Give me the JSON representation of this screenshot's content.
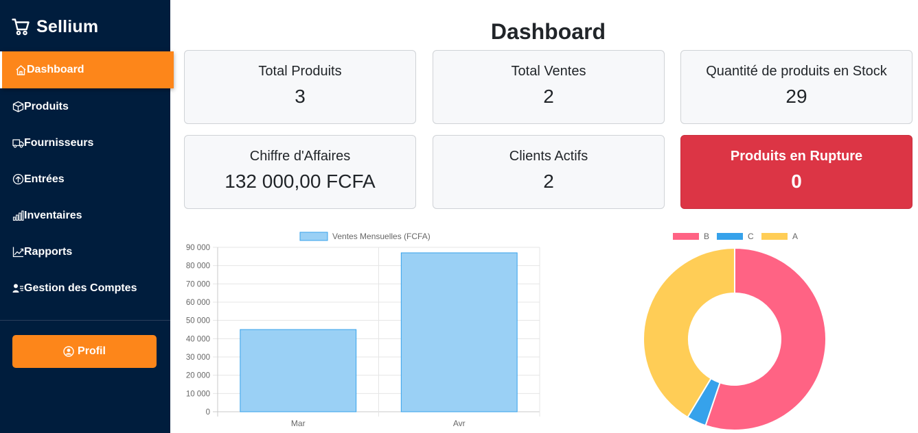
{
  "app": {
    "name": "Sellium"
  },
  "sidebar": {
    "items": [
      {
        "label": "Dashboard",
        "icon": "home-icon",
        "active": true
      },
      {
        "label": "Produits",
        "icon": "box-icon",
        "active": false
      },
      {
        "label": "Fournisseurs",
        "icon": "truck-icon",
        "active": false
      },
      {
        "label": "Entrées",
        "icon": "arrow-up-circle-icon",
        "active": false
      },
      {
        "label": "Inventaires",
        "icon": "bar-chart-icon",
        "active": false
      },
      {
        "label": "Rapports",
        "icon": "graph-up-icon",
        "active": false
      },
      {
        "label": "Gestion des Comptes",
        "icon": "user-list-icon",
        "active": false
      }
    ],
    "profile_button": "Profil"
  },
  "main": {
    "title": "Dashboard",
    "cards": [
      {
        "label": "Total Produits",
        "value": "3"
      },
      {
        "label": "Total Ventes",
        "value": "2"
      },
      {
        "label": "Quantité de produits en Stock",
        "value": "29"
      },
      {
        "label": "Chiffre d'Affaires",
        "value": "132 000,00 FCFA"
      },
      {
        "label": "Clients Actifs",
        "value": "2"
      },
      {
        "label": "Produits en Rupture",
        "value": "0"
      }
    ]
  },
  "colors": {
    "sidebar_bg": "#001d3d",
    "accent": "#fd861a",
    "danger": "#dc3545",
    "bar_fill": "#9ad0f5",
    "bar_border": "#36a2eb",
    "pie_b": "#ff6384",
    "pie_c": "#36a2eb",
    "pie_a": "#ffcd56"
  },
  "chart_data": [
    {
      "type": "bar",
      "legend": [
        "Ventes Mensuelles (FCFA)"
      ],
      "legend_position": "top",
      "categories": [
        "Mar",
        "Avr"
      ],
      "series": [
        {
          "name": "Ventes Mensuelles (FCFA)",
          "values": [
            45000,
            87000
          ]
        }
      ],
      "ylim": [
        0,
        90000
      ],
      "yticks": [
        "0",
        "10 000",
        "20 000",
        "30 000",
        "40 000",
        "50 000",
        "60 000",
        "70 000",
        "80 000",
        "90 000"
      ],
      "grid": true
    },
    {
      "type": "pie",
      "variant": "doughnut",
      "legend_position": "top",
      "labels": [
        "B",
        "C",
        "A"
      ],
      "values": [
        16,
        1,
        12
      ]
    }
  ]
}
